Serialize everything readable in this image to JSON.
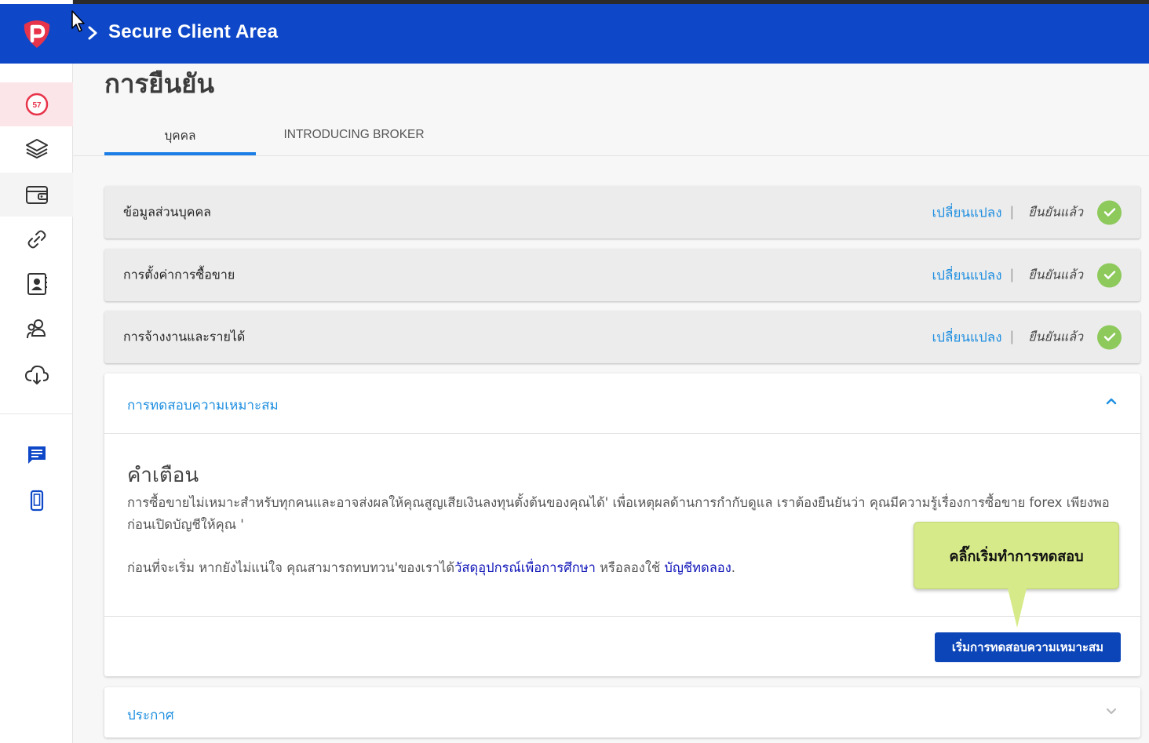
{
  "colors": {
    "header_bg": "#0e48c8",
    "accent_link": "#1f8fe0",
    "verified_green": "#8dc95b",
    "primary_button": "#0c45b8",
    "callout_bg": "#d6ea8a"
  },
  "header": {
    "title": "Secure Client Area"
  },
  "sidebar": {
    "logo_icon": "pepperstone-logo-icon",
    "badge_count": "57",
    "items": [
      {
        "icon": "notification-badge-icon",
        "active": true
      },
      {
        "icon": "layers-icon"
      },
      {
        "icon": "wallet-icon"
      },
      {
        "icon": "link-icon"
      },
      {
        "icon": "contact-book-icon"
      },
      {
        "icon": "users-icon"
      },
      {
        "icon": "cloud-download-icon"
      },
      {
        "icon": "chat-icon"
      },
      {
        "icon": "mobile-icon"
      }
    ]
  },
  "page": {
    "title": "การยืนยัน"
  },
  "tabs": [
    {
      "label": "บุคคล",
      "active": true
    },
    {
      "label": "INTRODUCING BROKER",
      "active": false
    }
  ],
  "sections": [
    {
      "label": "ข้อมูลส่วนบุคคล",
      "edit_label": "เปลี่ยนแปลง",
      "separator": "|",
      "status": "ยืนยันแล้ว"
    },
    {
      "label": "การตั้งค่าการซื้อขาย",
      "edit_label": "เปลี่ยนแปลง",
      "separator": "|",
      "status": "ยืนยันแล้ว"
    },
    {
      "label": "การจ้างงานและรายได้",
      "edit_label": "เปลี่ยนแปลง",
      "separator": "|",
      "status": "ยืนยันแล้ว"
    }
  ],
  "suitability": {
    "title": "การทดสอบความเหมาะสม",
    "warning_title": "คำเตือน",
    "warning_text": "การซื้อขายไม่เหมาะสำหรับทุกคนและอาจส่งผลให้คุณสูญเสียเงินลงทุนตั้งต้นของคุณได้' เพื่อเหตุผลด้านการกำกับดูแล เราต้องยืนยันว่า คุณมีความรู้เรื่องการซื้อขาย forex เพียงพอก่อนเปิดบัญชีให้คุณ '",
    "text_before_link": "ก่อนที่จะเริ่ม หากยังไม่แน่ใจ คุณสามารถทบทวน'ของเราได้",
    "education_link": "วัสดุอุปกรณ์เพื่อการศึกษา",
    "text_middle": " หรือลองใช้ ",
    "demo_link": "บัญชีทดลอง",
    "text_end": ".",
    "start_button": "เริ่มการทดสอบความเหมาะสม"
  },
  "callout": {
    "text": "คลิ๊กเริ่มทำการทดสอบ"
  },
  "announcement": {
    "title": "ประกาศ"
  }
}
